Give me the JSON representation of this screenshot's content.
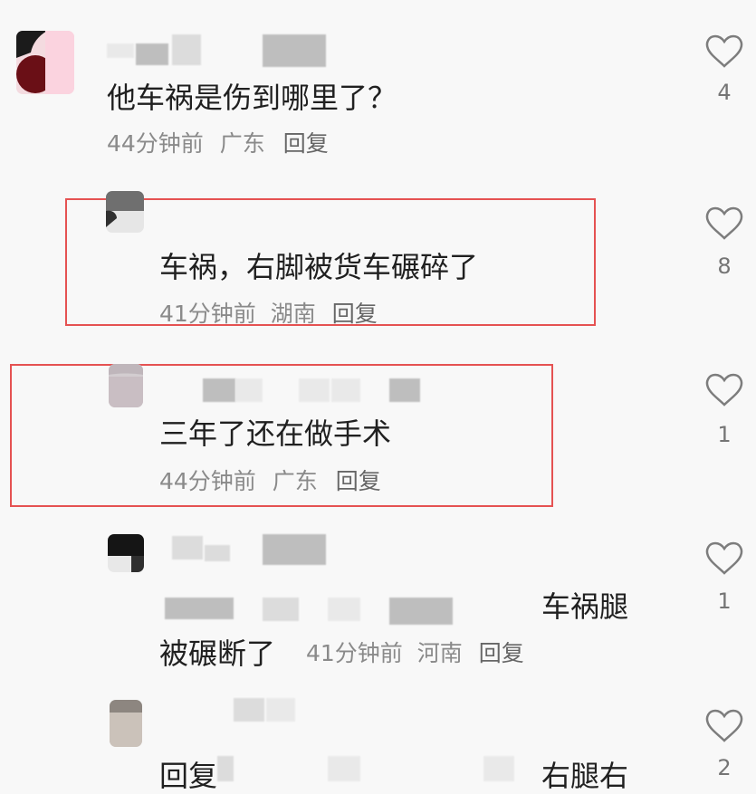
{
  "comments": [
    {
      "text": "他车祸是伤到哪里了？",
      "meta_time": "44分钟前",
      "meta_loc": "广东",
      "reply": "回复",
      "likes": "4"
    },
    {
      "text": "车祸，右脚被货车碾碎了",
      "meta_time": "41分钟前",
      "meta_loc": "湖南",
      "reply": "回复",
      "likes": "8"
    },
    {
      "text": "三年了还在做手术",
      "meta_time": "44分钟前",
      "meta_loc": "广东",
      "reply": "回复",
      "likes": "1"
    },
    {
      "text_tail": "车祸腿",
      "text_line2": "被碾断了",
      "meta_time": "41分钟前",
      "meta_loc": "河南",
      "reply": "回复",
      "likes": "1"
    },
    {
      "reply": "回复",
      "text_tail": "右腿右",
      "likes": "2"
    }
  ],
  "colors": {
    "highlight": "#e55252",
    "heart_stroke": "#7d7d7d"
  },
  "icons": {
    "like": "heart-outline-icon"
  }
}
